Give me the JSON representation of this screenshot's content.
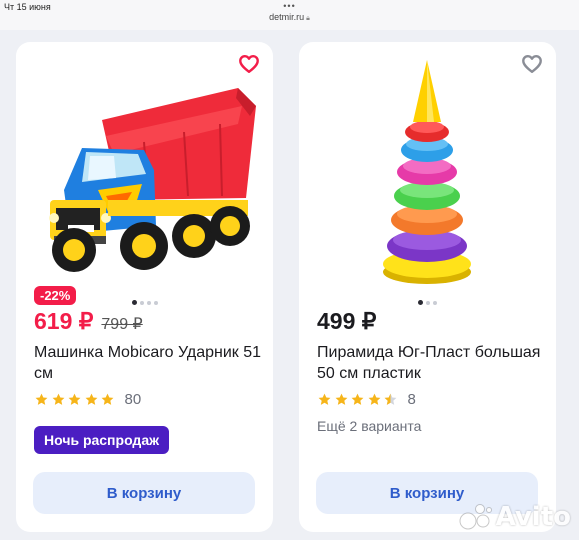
{
  "status_bar": {
    "time": "Чт 15 июня",
    "dots": "•••",
    "url": "detmir.ru",
    "lock_icon": "lock-icon"
  },
  "products": [
    {
      "favorite_icon": "heart-icon",
      "favorite_color": "#f31d49",
      "image_subject": "toy dump truck",
      "gallery_dots": 4,
      "gallery_active": 0,
      "discount": "-22%",
      "price": "619 ₽",
      "old_price": "799 ₽",
      "title": "Машинка Mobicaro Ударник 51 см",
      "rating_stars": 5,
      "rating_count": "80",
      "promo_label": "Ночь распродаж",
      "cart_button": "В корзину"
    },
    {
      "favorite_icon": "heart-icon",
      "favorite_color": "#8a8d96",
      "image_subject": "toy ring pyramid",
      "gallery_dots": 3,
      "gallery_active": 0,
      "price": "499 ₽",
      "title": "Пирамида Юг-Пласт большая 50 см пластик",
      "rating_stars": 4.5,
      "rating_count": "8",
      "variants": "Ещё 2 варианта",
      "cart_button": "В корзину"
    }
  ],
  "colors": {
    "sale_red": "#f31d49",
    "promo_purple": "#4b1ec2",
    "button_bg": "#e7eefb",
    "button_text": "#2f5ccb",
    "star": "#f6b51a"
  },
  "watermark": {
    "text": "Avito",
    "icon": "avito-logo-icon"
  }
}
